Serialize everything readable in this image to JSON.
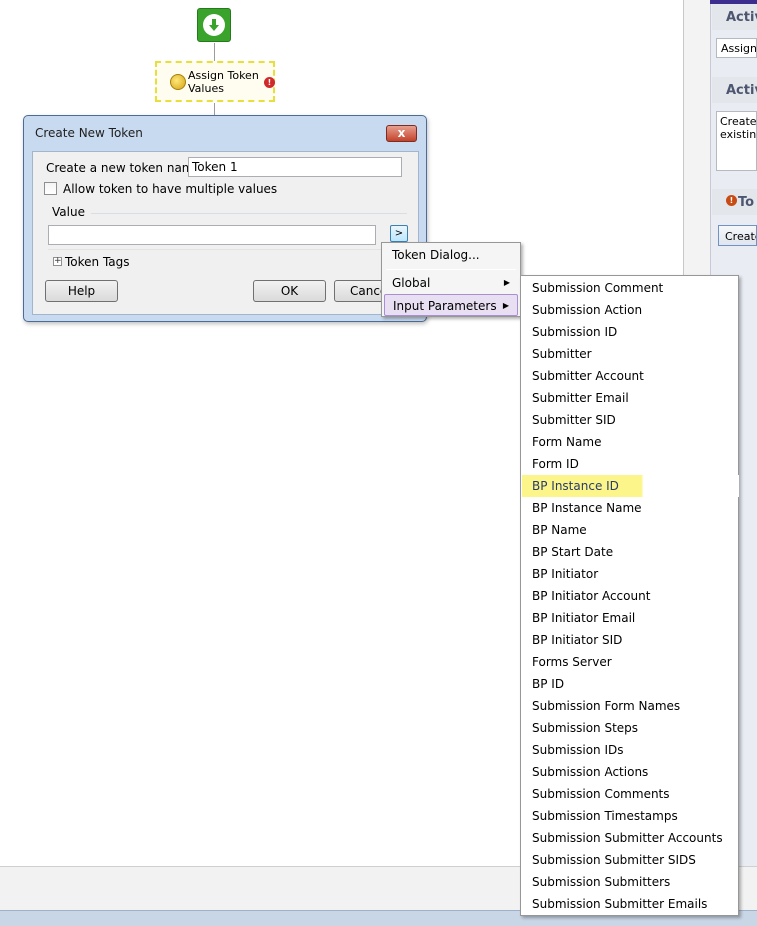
{
  "canvas": {
    "activity": {
      "title": "Assign Token Values",
      "warning_glyph": "!"
    }
  },
  "right_panel": {
    "header1": "Activ",
    "box1_value": "Assign T",
    "header2": "Activ",
    "description": "Creates existing",
    "header3": "To",
    "warning_glyph": "!",
    "button_label": "Create"
  },
  "dialog": {
    "title": "Create New Token",
    "close_glyph": "x",
    "name_label": "Create a new token named:",
    "name_value": "Token 1",
    "multi_label": "Allow token to have multiple values",
    "value_label": "Value",
    "value_input": "",
    "picker_glyph": ">",
    "expand_glyph": "+",
    "token_tags_label": "Token Tags",
    "help_label": "Help",
    "ok_label": "OK",
    "cancel_label": "Cancel"
  },
  "context_menu": {
    "items": [
      {
        "label": "Token Dialog...",
        "has_submenu": false
      },
      {
        "label": "Global",
        "has_submenu": true
      },
      {
        "label": "Input Parameters",
        "has_submenu": true,
        "selected": true
      }
    ],
    "arrow_glyph": "▶"
  },
  "submenu": {
    "highlighted_index": 9,
    "items": [
      "Submission Comment",
      "Submission Action",
      "Submission ID",
      "Submitter",
      "Submitter Account",
      "Submitter Email",
      "Submitter SID",
      "Form Name",
      "Form ID",
      "BP Instance ID",
      "BP Instance Name",
      "BP Name",
      "BP Start Date",
      "BP Initiator",
      "BP Initiator Account",
      "BP Initiator Email",
      "BP Initiator SID",
      "Forms Server",
      "BP ID",
      "Submission Form Names",
      "Submission Steps",
      "Submission IDs",
      "Submission Actions",
      "Submission Comments",
      "Submission Timestamps",
      "Submission Submitter Accounts",
      "Submission Submitter SIDS",
      "Submission Submitters",
      "Submission Submitter Emails"
    ]
  },
  "colors": {
    "highlight": "#fbf58a",
    "dialog_frame": "#c8daf0",
    "start_node": "#3aa32c",
    "accent_purple": "#3b2e8e"
  }
}
